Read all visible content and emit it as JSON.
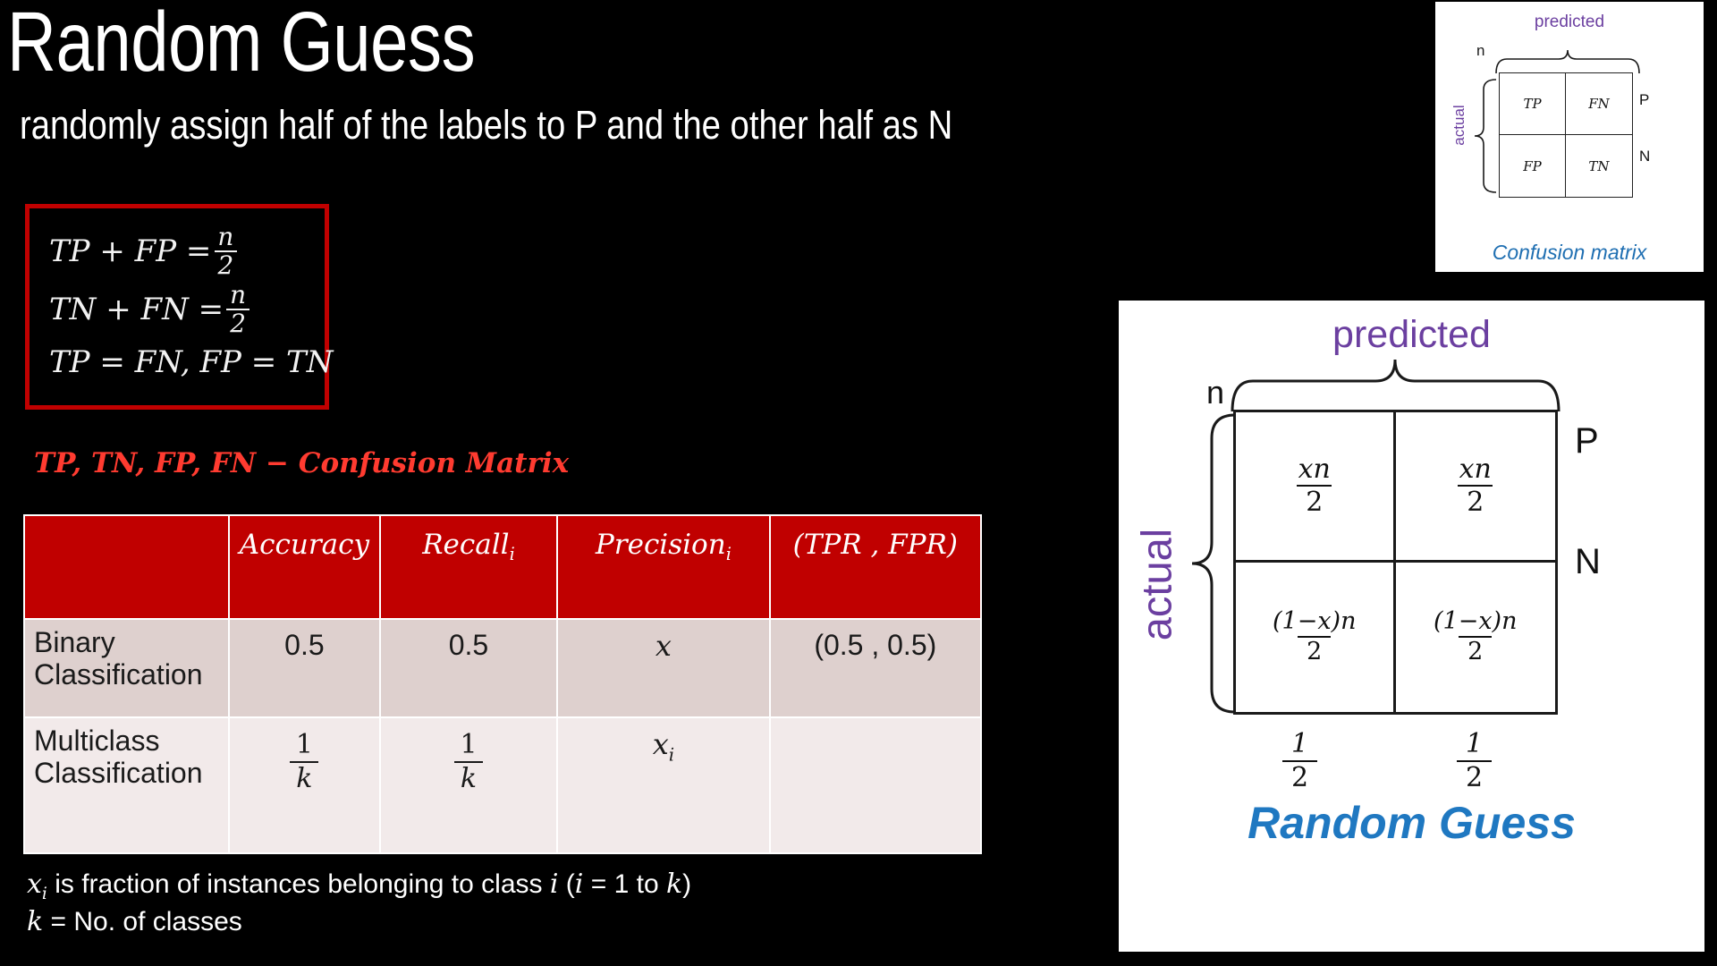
{
  "slide": {
    "title": "Random Guess",
    "subtitle": "randomly assign half of the labels to P and the other half as N",
    "background_color": "#000000",
    "accent_red": "#C00000",
    "accent_blue": "#1F78C1",
    "accent_purple": "#6B3FA0"
  },
  "formula_box": {
    "border_color": "#C00000",
    "equations": [
      {
        "lhs": "TP + FP =",
        "rhs_num": "n",
        "rhs_den": "2"
      },
      {
        "lhs": "TN + FN =",
        "rhs_num": "n",
        "rhs_den": "2"
      }
    ],
    "equation3": "TP = FN, FP = TN"
  },
  "confusion_caption": "TP, TN, FP, FN  − Confusion Matrix",
  "metrics_table": {
    "headers": [
      "",
      "Accuracy",
      "Recall",
      "Precision",
      "(TPR , FPR)"
    ],
    "header_subscripts": [
      "",
      "",
      "i",
      "i",
      ""
    ],
    "rows": [
      {
        "label": "Binary Classification",
        "accuracy": "0.5",
        "recall": "0.5",
        "precision": "x",
        "tpr_fpr": "(0.5 , 0.5)"
      },
      {
        "label": "Multiclass Classification",
        "accuracy_num": "1",
        "accuracy_den": "k",
        "recall_num": "1",
        "recall_den": "k",
        "precision": "x",
        "precision_sub": "i",
        "tpr_fpr": ""
      }
    ],
    "header_bg": "#C00000",
    "row1_bg": "#DED0CE",
    "row2_bg": "#F2EAEA"
  },
  "footnotes": {
    "line1_a": "x",
    "line1_sub": "i",
    "line1_b": " is fraction of instances belonging to class ",
    "line1_i": "i",
    "line1_c": " (",
    "line1_i2": "i",
    "line1_d": " = 1 to ",
    "line1_k": "k",
    "line1_e": ")",
    "line2_k": "k",
    "line2_rest": " = No. of classes"
  },
  "thumbnail_matrix": {
    "predicted_label": "predicted",
    "actual_label": "actual",
    "n_label": "n",
    "cells": {
      "tl": "TP",
      "tr": "FN",
      "bl": "FP",
      "br": "TN"
    },
    "row_labels": {
      "top": "P",
      "bottom": "N"
    },
    "caption": "Confusion matrix"
  },
  "big_matrix": {
    "predicted_label": "predicted",
    "actual_label": "actual",
    "n_label": "n",
    "cells": {
      "tl": {
        "num": "xn",
        "den": "2"
      },
      "tr": {
        "num": "xn",
        "den": "2"
      },
      "bl": {
        "num": "(1−x)n",
        "den": "2"
      },
      "br": {
        "num": "(1−x)n",
        "den": "2"
      }
    },
    "row_labels": {
      "top": "P",
      "bottom": "N"
    },
    "col_totals": [
      {
        "num": "1",
        "den": "2"
      },
      {
        "num": "1",
        "den": "2"
      }
    ],
    "caption": "Random Guess"
  }
}
